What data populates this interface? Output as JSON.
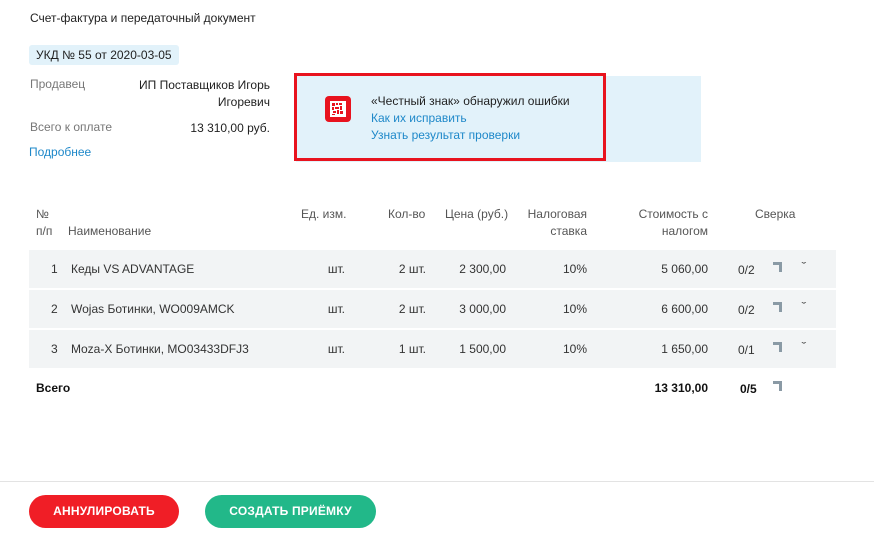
{
  "document": {
    "type": "Счет-фактура и передаточный документ",
    "badge": "УКД № 55 от 2020-03-05"
  },
  "info": {
    "seller_label": "Продавец",
    "seller_value_line1": "ИП Поставщиков Игорь",
    "seller_value_line2": "Игоревич",
    "total_label": "Всего к оплате",
    "total_value": "13 310,00 руб.",
    "more_link": "Подробнее"
  },
  "alert": {
    "title": "«Честный знак» обнаружил ошибки",
    "link1": "Как их исправить",
    "link2": "Узнать результат проверки",
    "icon": "honest-sign-icon",
    "icon_color": "#e8131e"
  },
  "table": {
    "headers": {
      "num_line1": "№",
      "num_line2": "п/п",
      "name": "Наименование",
      "unit": "Ед. изм.",
      "qty": "Кол-во",
      "price": "Цена (руб.)",
      "tax_line1": "Налоговая",
      "tax_line2": "ставка",
      "cost_line1": "Стоимость с",
      "cost_line2": "налогом",
      "check": "Сверка"
    },
    "rows": [
      {
        "num": "1",
        "name": "Кеды VS ADVANTAGE",
        "unit": "шт.",
        "qty": "2 шт.",
        "price": "2 300,00",
        "tax": "10%",
        "cost": "5 060,00",
        "check": "0/2"
      },
      {
        "num": "2",
        "name": "Wojas Ботинки, WO009AMCK",
        "unit": "шт.",
        "qty": "2 шт.",
        "price": "3 000,00",
        "tax": "10%",
        "cost": "6 600,00",
        "check": "0/2"
      },
      {
        "num": "3",
        "name": "Moza-X Ботинки, MO03433DFJ3",
        "unit": "шт.",
        "qty": "1 шт.",
        "price": "1 500,00",
        "tax": "10%",
        "cost": "1 650,00",
        "check": "0/1"
      }
    ],
    "total": {
      "label": "Всего",
      "cost": "13 310,00",
      "check": "0/5"
    }
  },
  "actions": {
    "cancel": "АННУЛИРОВАТЬ",
    "create": "СОЗДАТЬ ПРИЁМКУ"
  },
  "colors": {
    "accent_blue": "#1e88c9",
    "danger": "#f01e26",
    "success": "#22b889",
    "highlight_bg": "#e2f2fa"
  }
}
